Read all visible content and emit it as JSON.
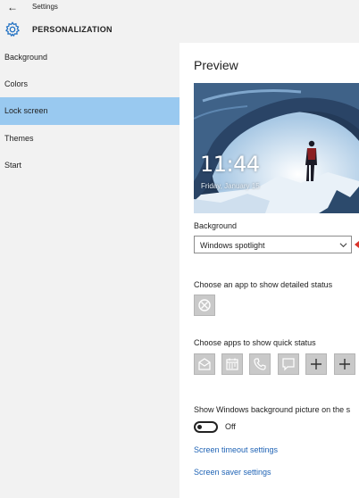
{
  "window": {
    "title": "Settings",
    "back_icon": "back-arrow-icon"
  },
  "header": {
    "title": "PERSONALIZATION",
    "icon": "gear-icon",
    "accent": "#1e6fc2"
  },
  "sidebar": {
    "items": [
      {
        "label": "Background",
        "active": false
      },
      {
        "label": "Colors",
        "active": false
      },
      {
        "label": "Lock screen",
        "active": true
      },
      {
        "label": "Themes",
        "active": false
      },
      {
        "label": "Start",
        "active": false
      }
    ],
    "active_color": "#99c9f0"
  },
  "main": {
    "preview_title": "Preview",
    "preview": {
      "time": "11:44",
      "date": "Friday, January 15"
    },
    "background_label": "Background",
    "background_value": "Windows spotlight",
    "detailed_status_label": "Choose an app to show detailed status",
    "detailed_status_apps": [
      "xbox-icon"
    ],
    "quick_status_label": "Choose apps to show quick status",
    "quick_status_apps": [
      "mail-icon",
      "calendar-icon",
      "phone-icon",
      "message-icon",
      "plus-icon",
      "plus-icon"
    ],
    "show_bg_label": "Show Windows background picture on the s",
    "toggle": {
      "state": "Off",
      "on": false
    },
    "links": [
      "Screen timeout settings",
      "Screen saver settings"
    ],
    "link_color": "#1f63b5"
  }
}
